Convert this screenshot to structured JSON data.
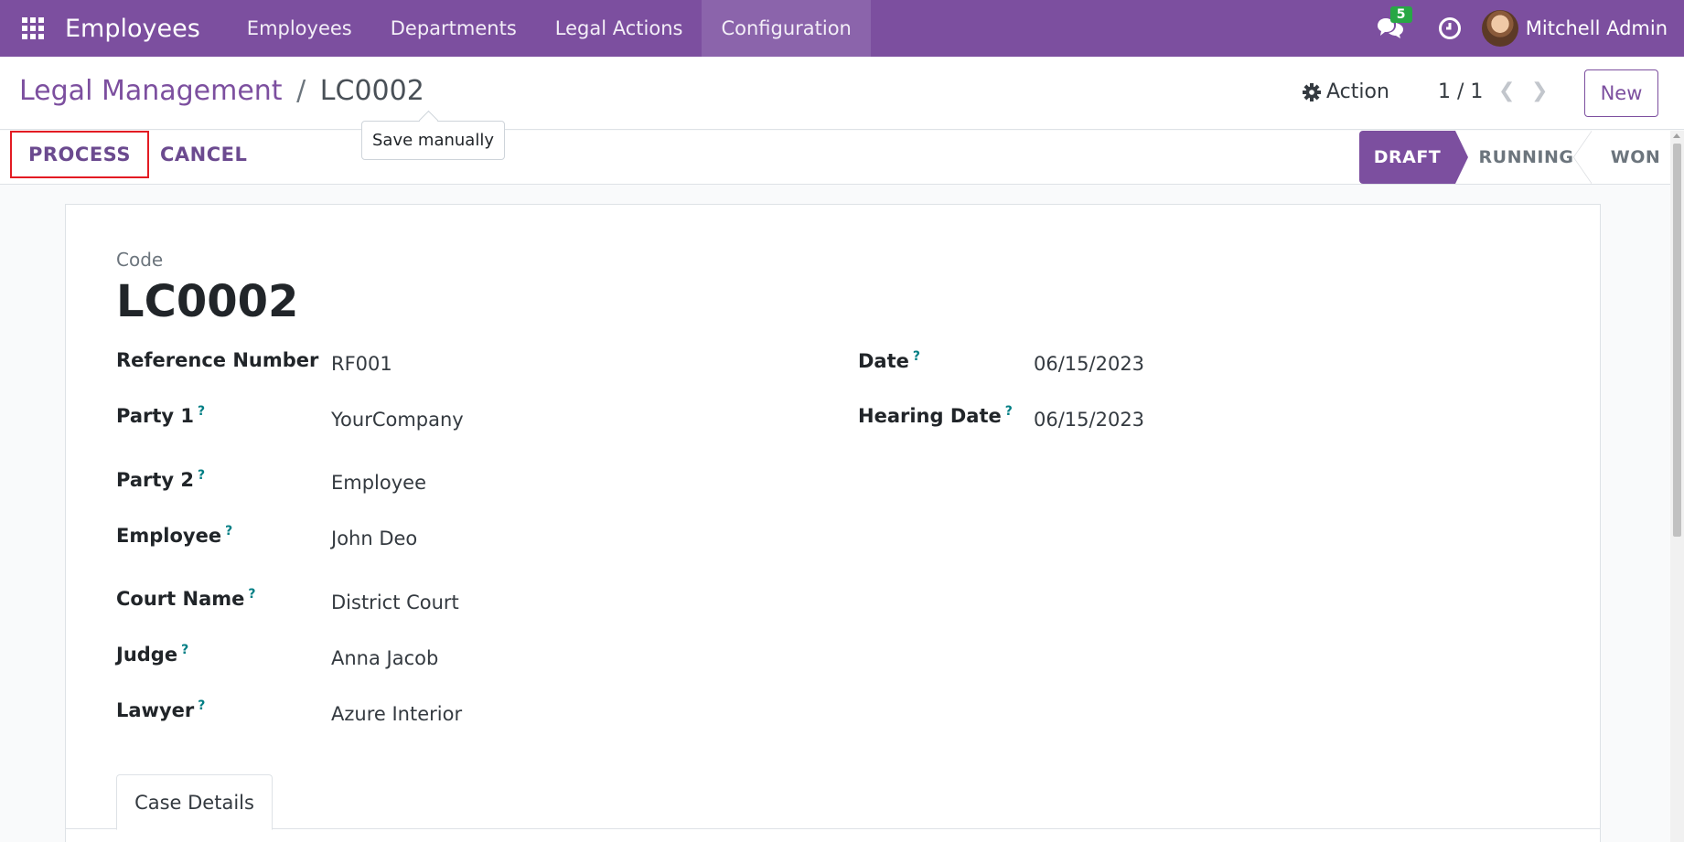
{
  "navbar": {
    "app_name": "Employees",
    "menu": [
      "Employees",
      "Departments",
      "Legal Actions",
      "Configuration"
    ],
    "active_menu": "Configuration",
    "chat_count": "5",
    "user_name": "Mitchell Admin"
  },
  "breadcrumb": {
    "parent": "Legal Management",
    "separator": "/",
    "current": "LC0002"
  },
  "tooltip": "Save manually",
  "control": {
    "action_label": "Action",
    "pager": "1 / 1",
    "new_label": "New"
  },
  "statusbar": {
    "process_label": "PROCESS",
    "cancel_label": "CANCEL",
    "stages": [
      "DRAFT",
      "RUNNING",
      "WON"
    ],
    "active_stage": "DRAFT"
  },
  "form": {
    "code_label": "Code",
    "code_value": "LC0002",
    "fields_left": [
      {
        "label": "Reference Number",
        "help": "",
        "value": "RF001"
      },
      {
        "label": "Party 1",
        "help": "?",
        "value": "YourCompany"
      },
      {
        "label": "Party 2",
        "help": "?",
        "value": "Employee"
      },
      {
        "label": "Employee",
        "help": "?",
        "value": "John Deo"
      },
      {
        "label": "Court Name",
        "help": "?",
        "value": "District Court"
      },
      {
        "label": "Judge",
        "help": "?",
        "value": "Anna Jacob"
      },
      {
        "label": "Lawyer",
        "help": "?",
        "value": "Azure Interior"
      }
    ],
    "fields_right": [
      {
        "label": "Date",
        "help": "?",
        "value": "06/15/2023"
      },
      {
        "label": "Hearing Date",
        "help": "?",
        "value": "06/15/2023"
      }
    ],
    "tab_label": "Case Details"
  },
  "colors": {
    "brand": "#7c4f9f",
    "highlight_border": "#e31b23",
    "help_mark": "#017e84",
    "badge": "#28a745"
  }
}
